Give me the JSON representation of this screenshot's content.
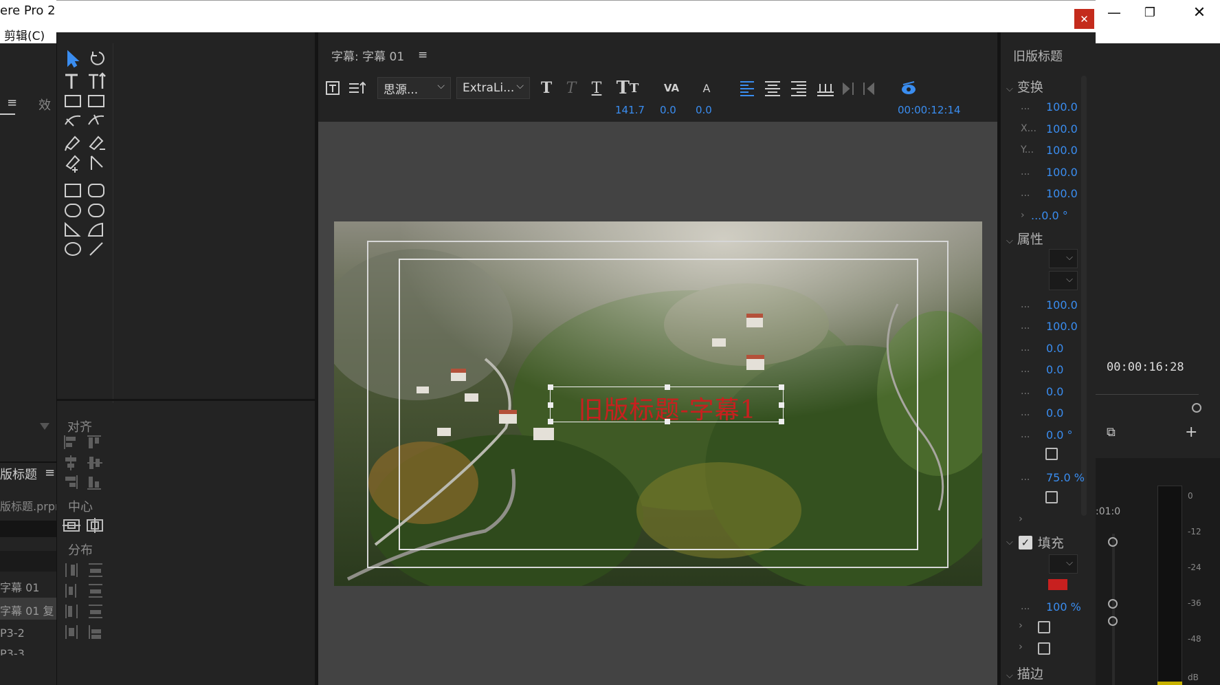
{
  "app": {
    "title": "ere Pro 2(",
    "menu_edit": "剪辑(C)"
  },
  "window": {
    "minimize": "—",
    "restore": "❐",
    "close": "✕",
    "dialog_close": "✕"
  },
  "left_panel": {
    "effects_tab": "效",
    "menu_icon": "≡",
    "titles_tab": "版标题",
    "project_file": "版标题.prpr",
    "items": [
      "字幕 01",
      "字幕 01 复",
      "P3-2",
      "P3-3"
    ]
  },
  "tools_panel": {
    "align_label": "对齐",
    "center_label": "中心",
    "distribute_label": "分布"
  },
  "editor": {
    "title": "字幕: 字幕 01",
    "menu_icon": "≡",
    "font_family": "思源...",
    "font_style": "ExtraLi...",
    "font_size": "141.7",
    "kerning": "0.0",
    "leading": "0.0",
    "timecode": "00:00:12:14",
    "caption_text": "旧版标题-字幕1"
  },
  "properties": {
    "panel_title": "旧版标题",
    "transform_label": "变换",
    "attributes_label": "属性",
    "fill_label": "填充",
    "stroke_label": "描边",
    "x_key": "X...",
    "y_key": "Y...",
    "dots": "...",
    "transform_values": [
      "100.0",
      "100.0",
      "100.0",
      "100.0",
      "100.0",
      "...0.0 °"
    ],
    "attr_values": [
      "100.0",
      "100.0",
      "0.0",
      "0.0",
      "0.0",
      "0.0",
      "0.0 °"
    ],
    "percent_75": "75.0 %",
    "percent_100": "100 %",
    "fill_color": "#c8201f"
  },
  "right_panel": {
    "timecode": "00:00:16:28",
    "ruler_time": ":01:0",
    "meter_ticks": [
      "0",
      "-12",
      "-24",
      "-36",
      "-48",
      "dB"
    ]
  }
}
